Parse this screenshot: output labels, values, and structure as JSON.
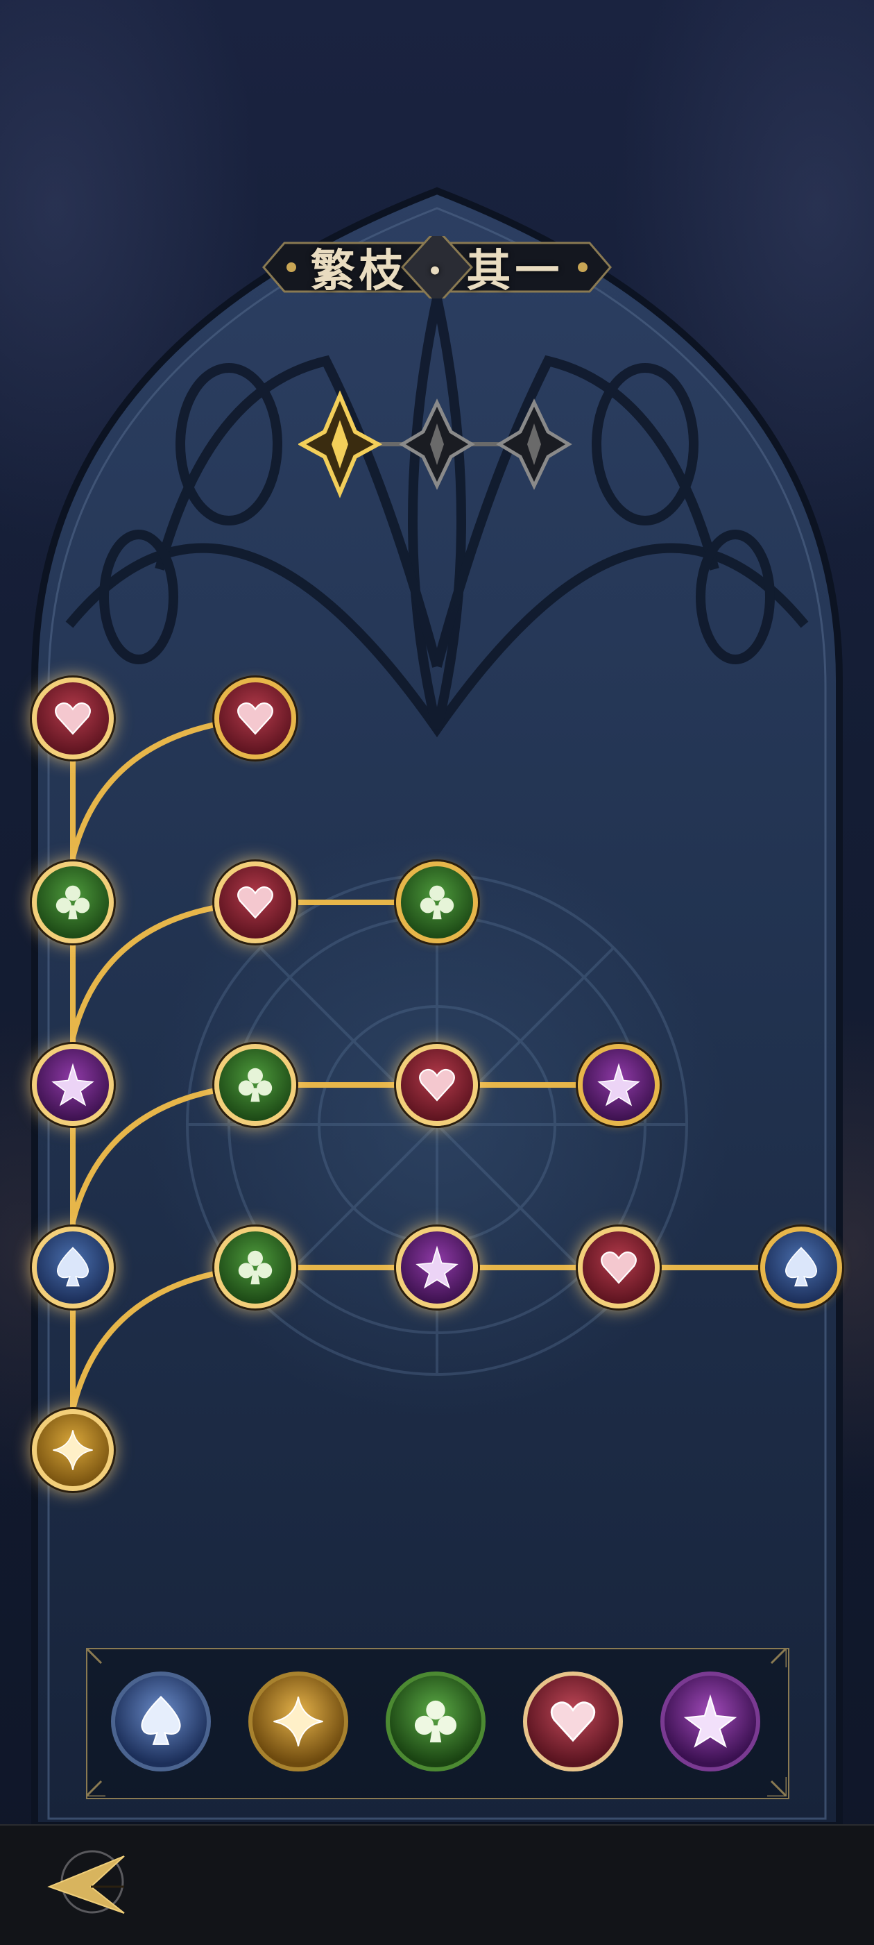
{
  "title": "繁枝 · 其一",
  "icons": {
    "heart": "heart-icon",
    "club": "club-icon",
    "star": "star-icon",
    "spade": "spade-icon",
    "gold": "sparkle-icon",
    "back": "back-arrow-icon"
  },
  "colors": {
    "gold": "#e7b64a",
    "heart": "#8e2232",
    "club": "#2f6e24",
    "star": "#6a2480",
    "spade": "#2f4a86",
    "sparkle": "#b08020"
  },
  "page_indicator": {
    "pages": 3,
    "current": 1
  },
  "tree": {
    "nodes": [
      {
        "id": "r0c0",
        "type": "heart",
        "state": "active"
      },
      {
        "id": "r0c1",
        "type": "heart",
        "state": "tip"
      },
      {
        "id": "r1c0",
        "type": "club",
        "state": "active"
      },
      {
        "id": "r1c1",
        "type": "heart",
        "state": "active"
      },
      {
        "id": "r1c2",
        "type": "club",
        "state": "tip"
      },
      {
        "id": "r2c0",
        "type": "star",
        "state": "active"
      },
      {
        "id": "r2c1",
        "type": "club",
        "state": "active"
      },
      {
        "id": "r2c2",
        "type": "heart",
        "state": "active"
      },
      {
        "id": "r2c3",
        "type": "star",
        "state": "tip"
      },
      {
        "id": "r3c0",
        "type": "spade",
        "state": "active"
      },
      {
        "id": "r3c1",
        "type": "club",
        "state": "active"
      },
      {
        "id": "r3c2",
        "type": "star",
        "state": "active"
      },
      {
        "id": "r3c3",
        "type": "heart",
        "state": "active"
      },
      {
        "id": "r3c4",
        "type": "spade",
        "state": "tip"
      },
      {
        "id": "r4c0",
        "type": "gold",
        "state": "active"
      }
    ]
  },
  "legend": [
    "spade",
    "gold",
    "club",
    "heart",
    "star"
  ]
}
